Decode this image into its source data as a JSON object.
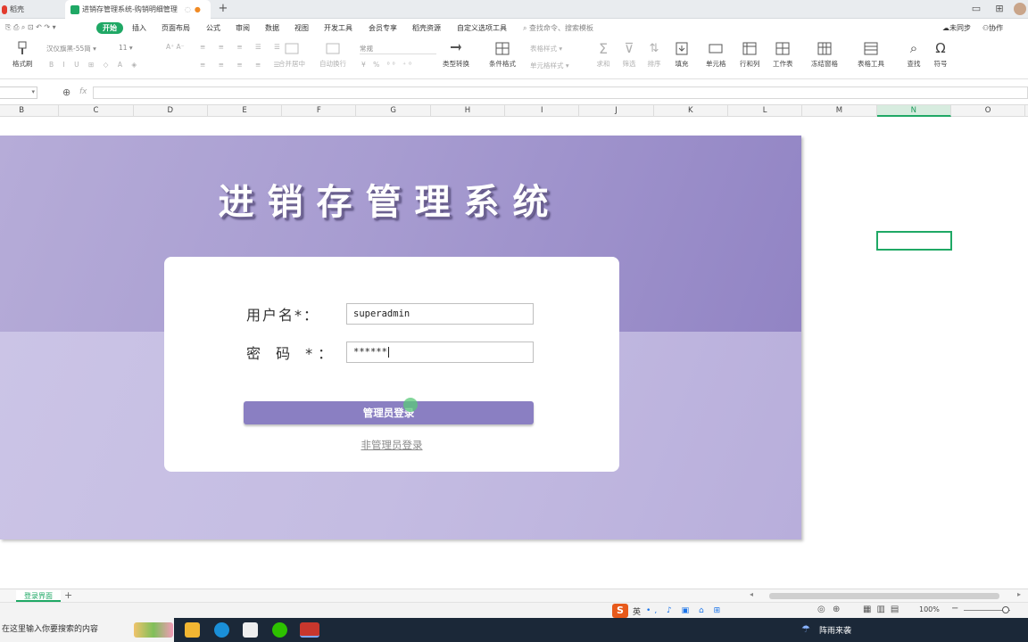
{
  "browser_tabs": [
    {
      "label": "稻壳",
      "active": false
    },
    {
      "label": "进销存管理系统-购销明细管理",
      "active": true
    }
  ],
  "menu": {
    "items": [
      "开始",
      "插入",
      "页面布局",
      "公式",
      "审阅",
      "数据",
      "视图",
      "开发工具",
      "会员专享",
      "稻壳资源",
      "自定义选项工具"
    ],
    "active": "开始",
    "search_placeholder": "查找命令、搜索模板",
    "sync_label": "未同步",
    "collab_label": "协作"
  },
  "ribbon": {
    "format_painter": "格式刷",
    "font_name": "汉仪旗黑-55简",
    "font_size": "11",
    "number_format": "常规",
    "merge_label": "合并居中",
    "wrap_label": "自动换行",
    "convert_label": "类型转换",
    "cond_format": "条件格式",
    "table_style": "表格样式",
    "cell_style": "单元格样式",
    "sum_label": "求和",
    "filter_label": "筛选",
    "sort_label": "排序",
    "fill_label": "填充",
    "cell_label": "单元格",
    "rowcol_label": "行和列",
    "sheet_label": "工作表",
    "freeze_label": "冻结窗格",
    "tools_label": "表格工具",
    "find_label": "查找",
    "symbol_label": "符号"
  },
  "columns": [
    "B",
    "C",
    "D",
    "E",
    "F",
    "G",
    "H",
    "I",
    "J",
    "K",
    "L",
    "M",
    "N",
    "O"
  ],
  "selected_column": "N",
  "login": {
    "title": "进销存管理系统",
    "username_label": "用户名*：",
    "username_value": "superadmin",
    "password_label": "密 码 *：",
    "password_value": "******",
    "admin_button": "管理员登录",
    "nonadmin_link": "非管理员登录"
  },
  "sheet_tab": "登录界面",
  "status": {
    "ime_lang": "英",
    "zoom": "100%"
  },
  "taskbar": {
    "search_placeholder": "在这里输入你要搜索的内容",
    "weather": "阵雨来袭"
  },
  "colors": {
    "accent_green": "#1fa865",
    "login_purple": "#8a7fc2"
  }
}
